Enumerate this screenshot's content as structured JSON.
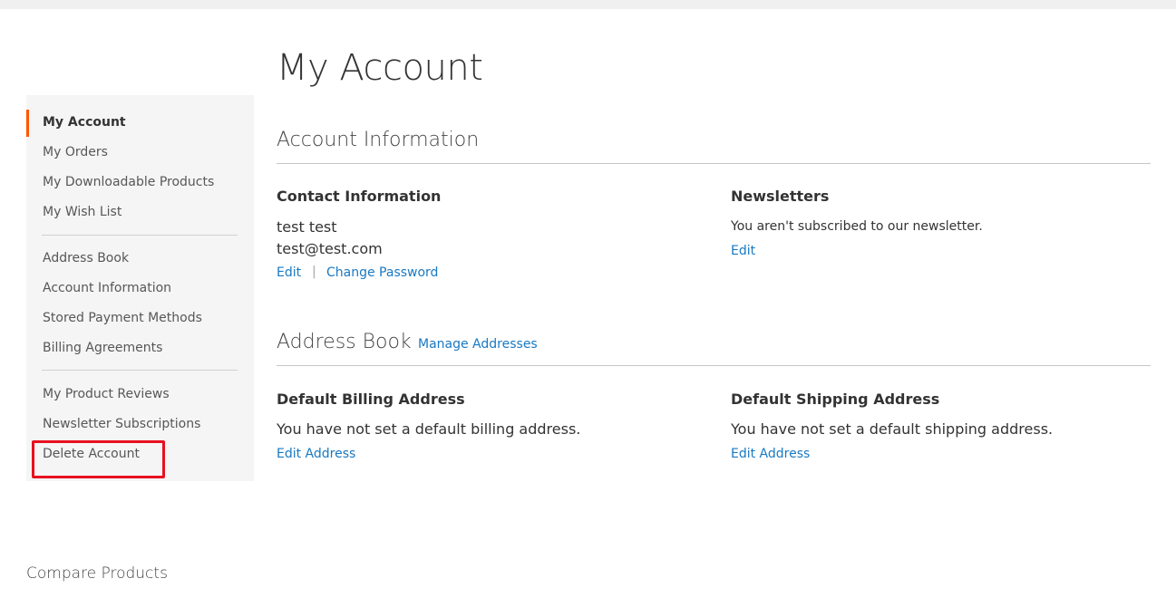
{
  "sidebar": {
    "items": [
      {
        "label": "My Account"
      },
      {
        "label": "My Orders"
      },
      {
        "label": "My Downloadable Products"
      },
      {
        "label": "My Wish List"
      },
      {
        "label": "Address Book"
      },
      {
        "label": "Account Information"
      },
      {
        "label": "Stored Payment Methods"
      },
      {
        "label": "Billing Agreements"
      },
      {
        "label": "My Product Reviews"
      },
      {
        "label": "Newsletter Subscriptions"
      },
      {
        "label": "Delete Account"
      }
    ]
  },
  "compare": {
    "title": "Compare Products"
  },
  "page": {
    "title": "My Account"
  },
  "account_information": {
    "title": "Account Information",
    "contact": {
      "title": "Contact Information",
      "name": "test test",
      "email": "test@test.com",
      "edit_label": "Edit",
      "separator": "|",
      "change_password_label": "Change Password"
    },
    "newsletters": {
      "title": "Newsletters",
      "status": "You aren't subscribed to our newsletter.",
      "edit_label": "Edit"
    }
  },
  "address_book": {
    "title": "Address Book",
    "manage_label": "Manage Addresses",
    "billing": {
      "title": "Default Billing Address",
      "text": "You have not set a default billing address.",
      "edit_label": "Edit Address"
    },
    "shipping": {
      "title": "Default Shipping Address",
      "text": "You have not set a default shipping address.",
      "edit_label": "Edit Address"
    }
  },
  "colors": {
    "accent": "#ff5501",
    "link": "#1979c3",
    "highlight": "#e8101f"
  }
}
